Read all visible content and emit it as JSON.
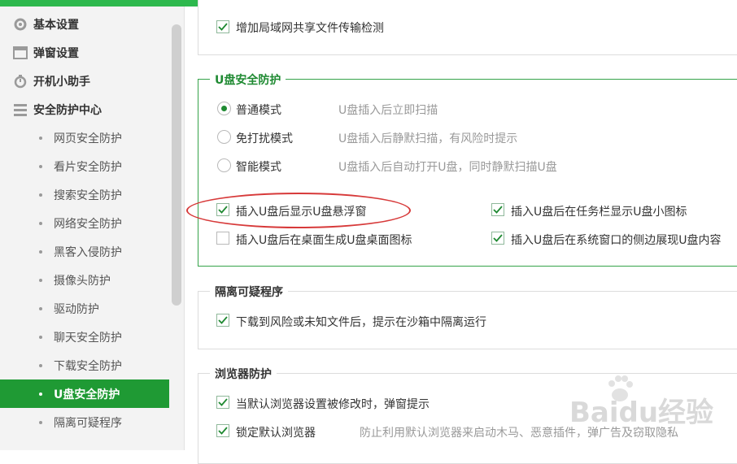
{
  "sidebar": {
    "top_items": [
      {
        "label": "基本设置",
        "icon": "gear-icon"
      },
      {
        "label": "弹窗设置",
        "icon": "window-icon"
      },
      {
        "label": "开机小助手",
        "icon": "timer-icon"
      },
      {
        "label": "安全防护中心",
        "icon": "grid-icon"
      }
    ],
    "sub_items": [
      {
        "label": "网页安全防护"
      },
      {
        "label": "看片安全防护"
      },
      {
        "label": "搜索安全防护"
      },
      {
        "label": "网络安全防护"
      },
      {
        "label": "黑客入侵防护"
      },
      {
        "label": "摄像头防护"
      },
      {
        "label": "驱动防护"
      },
      {
        "label": "聊天安全防护"
      },
      {
        "label": "下载安全防护"
      },
      {
        "label": "U盘安全防护"
      },
      {
        "label": "隔离可疑程序"
      }
    ],
    "active_label": "U盘安全防护"
  },
  "lan_section": {
    "checkbox_label": "增加局域网共享文件传输检测",
    "checked": true
  },
  "usb_section": {
    "title": "U盘安全防护",
    "modes": [
      {
        "label": "普通模式",
        "desc": "U盘插入后立即扫描",
        "selected": true
      },
      {
        "label": "免打扰模式",
        "desc": "U盘插入后静默扫描，有风险时提示",
        "selected": false
      },
      {
        "label": "智能模式",
        "desc": "U盘插入后自动打开U盘，同时静默扫描U盘",
        "selected": false
      }
    ],
    "options": [
      {
        "label": "插入U盘后显示U盘悬浮窗",
        "checked": true
      },
      {
        "label": "插入U盘后在任务栏显示U盘小图标",
        "checked": true
      },
      {
        "label": "插入U盘后在桌面生成U盘桌面图标",
        "checked": false
      },
      {
        "label": "插入U盘后在系统窗口的侧边展现U盘内容",
        "checked": true
      }
    ]
  },
  "isolate_section": {
    "title": "隔离可疑程序",
    "checkbox_label": "下载到风险或未知文件后，提示在沙箱中隔离运行",
    "checked": true
  },
  "browser_section": {
    "title": "浏览器防护",
    "options": [
      {
        "label": "当默认浏览器设置被修改时，弹窗提示",
        "checked": true,
        "desc": ""
      },
      {
        "label": "锁定默认浏览器",
        "checked": true,
        "desc": "防止利用默认浏览器来启动木马、恶意插件，弹广告及窃取隐私"
      }
    ]
  },
  "watermark": "Baidu经验",
  "colors": {
    "accent": "#2db84d",
    "active": "#1f9a34",
    "highlight_oval": "#d73a3a"
  }
}
